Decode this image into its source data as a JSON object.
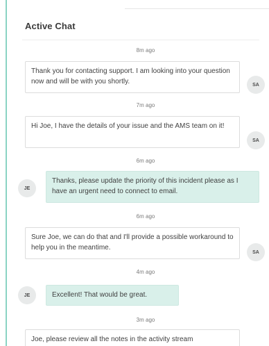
{
  "chat": {
    "title": "Active Chat",
    "messages": [
      {
        "time": "8m ago",
        "text": "Thank you for contacting support. I am looking into your question now and will be with you shortly.",
        "initials": "SA"
      },
      {
        "time": "7m ago",
        "text": "Hi Joe, I have the details of your issue and the AMS team on it!",
        "initials": "SA"
      },
      {
        "time": "6m ago",
        "text": "Thanks, please update the priority of this incident please as I have an urgent need to connect to email.",
        "initials": "JE"
      },
      {
        "time": "6m ago",
        "text": "Sure Joe, we can do that and I'll provide a possible workaround to help you in the meantime.",
        "initials": "SA"
      },
      {
        "time": "4m ago",
        "text": "Excellent! That would be great.",
        "initials": "JE"
      },
      {
        "time": "3m ago",
        "text": "Joe, please review all the notes in the activity stream",
        "initials": ""
      }
    ]
  },
  "colors": {
    "accent": "#8ad3c3",
    "user_bubble": "#d9f0ea",
    "agent_bubble_border": "#dcdcdc",
    "avatar_bg": "#e8eaea"
  }
}
